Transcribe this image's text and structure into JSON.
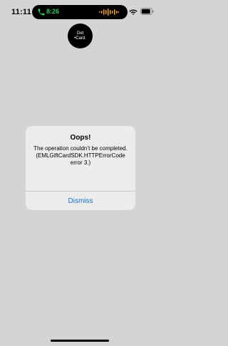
{
  "status_bar": {
    "time": "11:11",
    "call_time": "8:26",
    "accent_color": "#34c759",
    "waveform_color": "#f5a623",
    "icons": [
      "phone-icon",
      "waveform-icon",
      "wifi-icon",
      "battery-icon"
    ]
  },
  "logo": {
    "line1": "Get",
    "line2": "•Card."
  },
  "alert": {
    "title": "Oops!",
    "message": "The operation couldn’t be completed. (EMLGiftCardSDK.HTTPErrorCode error 3.)",
    "dismiss_label": "Dismiss",
    "button_color": "#1a73c7"
  }
}
